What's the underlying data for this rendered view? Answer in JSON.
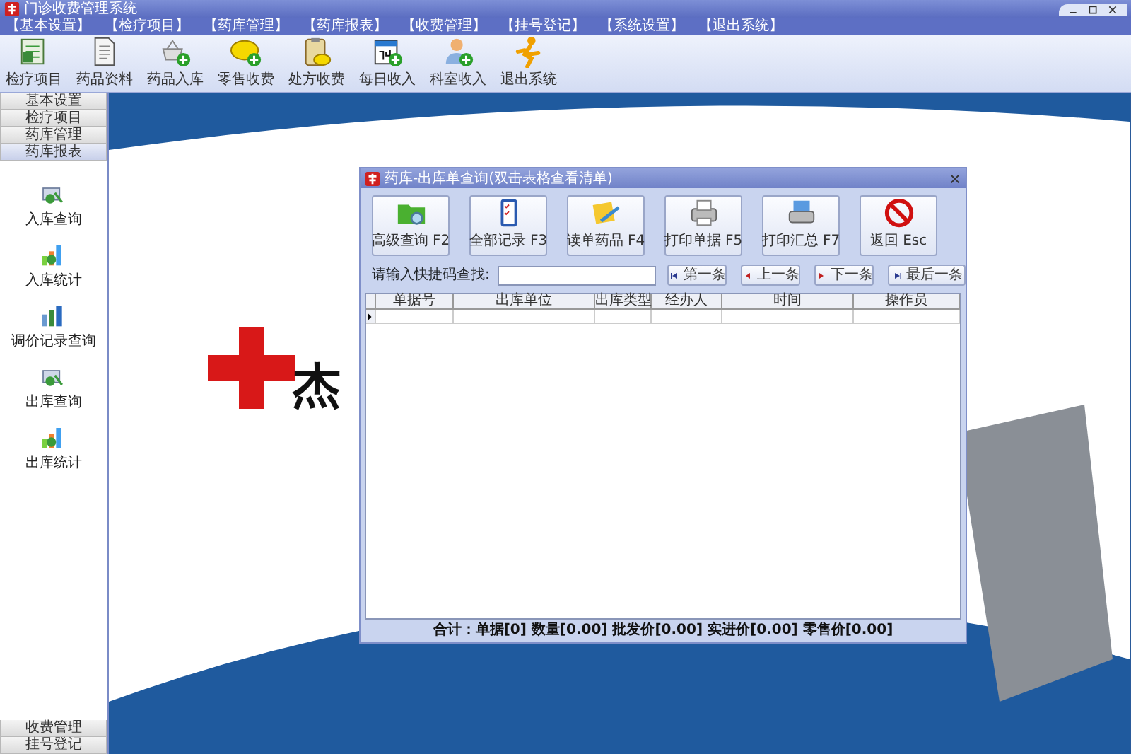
{
  "window": {
    "title": "门诊收费管理系统"
  },
  "menu": [
    "【基本设置】",
    "【检疗项目】",
    "【药库管理】",
    "【药库报表】",
    "【收费管理】",
    "【挂号登记】",
    "【系统设置】",
    "【退出系统】"
  ],
  "toolbar": [
    {
      "label": "检疗项目",
      "kind": "sheet"
    },
    {
      "label": "药品资料",
      "kind": "doc"
    },
    {
      "label": "药品入库",
      "kind": "basket"
    },
    {
      "label": "零售收费",
      "kind": "coin"
    },
    {
      "label": "处方收费",
      "kind": "clip"
    },
    {
      "label": "每日收入",
      "kind": "calendar"
    },
    {
      "label": "科室收入",
      "kind": "person"
    },
    {
      "label": "退出系统",
      "kind": "runner"
    }
  ],
  "sidebar": {
    "sections_top": [
      {
        "label": "基本设置",
        "selected": false
      },
      {
        "label": "检疗项目",
        "selected": false
      },
      {
        "label": "药库管理",
        "selected": false
      },
      {
        "label": "药库报表",
        "selected": true
      }
    ],
    "items": [
      {
        "label": "入库查询",
        "kind": "search"
      },
      {
        "label": "入库统计",
        "kind": "chart"
      },
      {
        "label": "调价记录查询",
        "kind": "bars"
      },
      {
        "label": "出库查询",
        "kind": "search"
      },
      {
        "label": "出库统计",
        "kind": "chart"
      }
    ],
    "sections_bottom": [
      {
        "label": "收费管理",
        "selected": false
      },
      {
        "label": "挂号登记",
        "selected": false
      }
    ]
  },
  "splash": {
    "text": "杰"
  },
  "dialog": {
    "title": "药库-出库单查询(双击表格查看清单)",
    "actions": [
      {
        "label": "高级查询 F2",
        "kind": "folder"
      },
      {
        "label": "全部记录 F3",
        "kind": "list"
      },
      {
        "label": "读单药品 F4",
        "kind": "pencil"
      },
      {
        "label": "打印单据 F5",
        "kind": "printer"
      },
      {
        "label": "打印汇总 F7",
        "kind": "printer2"
      },
      {
        "label": "返回 Esc",
        "kind": "stop"
      }
    ],
    "search": {
      "label": "请输入快捷码查找:"
    },
    "nav": [
      {
        "label": "第一条",
        "kind": "first"
      },
      {
        "label": "上一条",
        "kind": "prev"
      },
      {
        "label": "下一条",
        "kind": "next"
      },
      {
        "label": "最后一条",
        "kind": "last"
      }
    ],
    "table": {
      "columns": [
        "单据号",
        "出库单位",
        "出库类型",
        "经办人",
        "时间",
        "操作员"
      ],
      "rows": [
        {
          "current": true
        }
      ]
    },
    "summary": "合计：单据[0] 数量[0.00] 批发价[0.00] 实进价[0.00] 零售价[0.00]"
  }
}
